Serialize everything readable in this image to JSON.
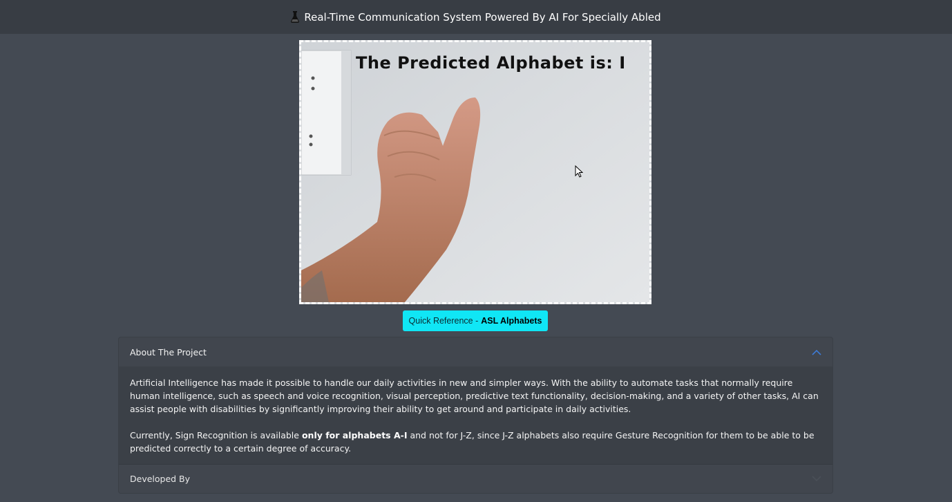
{
  "header": {
    "title": "Real-Time Communication System Powered By AI For Specially Abled",
    "icon": "flask-icon"
  },
  "video": {
    "prediction_text": "The Predicted Alphabet is: I"
  },
  "quick_reference": {
    "prefix": "Quick Reference -",
    "bold": "ASL Alphabets"
  },
  "accordion": {
    "about": {
      "title": "About The Project",
      "expanded": true,
      "paragraph1": "Artificial Intelligence has made it possible to handle our daily activities in new and simpler ways. With the ability to automate tasks that normally require human intelligence, such as speech and voice recognition, visual perception, predictive text functionality, decision-making, and a variety of other tasks, AI can assist people with disabilities by significantly improving their ability to get around and participate in daily activities.",
      "paragraph2_pre": "Currently, Sign Recognition is available ",
      "paragraph2_bold": "only for alphabets A-I",
      "paragraph2_post": " and not for J-Z, since J-Z alphabets also require Gesture Recognition for them to be able to be predicted correctly to a certain degree of accuracy."
    },
    "developed_by": {
      "title": "Developed By",
      "expanded": false
    }
  },
  "colors": {
    "background": "#444a53",
    "topbar": "#383d44",
    "accent_button": "#10e6f5",
    "chevron_active": "#3d7bd6"
  }
}
